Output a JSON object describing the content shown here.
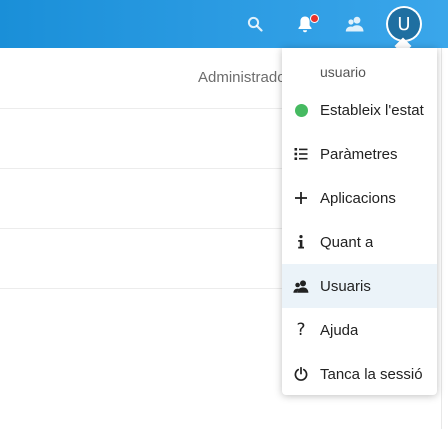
{
  "header": {
    "avatar_initial": "U",
    "accent_color": "#1a8fd8"
  },
  "background": {
    "visible_text": "Administradors"
  },
  "menu": {
    "user": "usuario",
    "items": [
      {
        "label": "Estableix l'estat",
        "icon": "status-dot"
      },
      {
        "label": "Paràmetres",
        "icon": "settings-list-icon"
      },
      {
        "label": "Aplicacions",
        "icon": "plus-icon"
      },
      {
        "label": "Quant a",
        "icon": "info-icon"
      },
      {
        "label": "Usuaris",
        "icon": "users-icon",
        "active": true
      },
      {
        "label": "Ajuda",
        "icon": "help-icon"
      },
      {
        "label": "Tanca la sessió",
        "icon": "power-icon"
      }
    ],
    "status_color": "#46ba61",
    "active_color": "#ebf3f9"
  }
}
